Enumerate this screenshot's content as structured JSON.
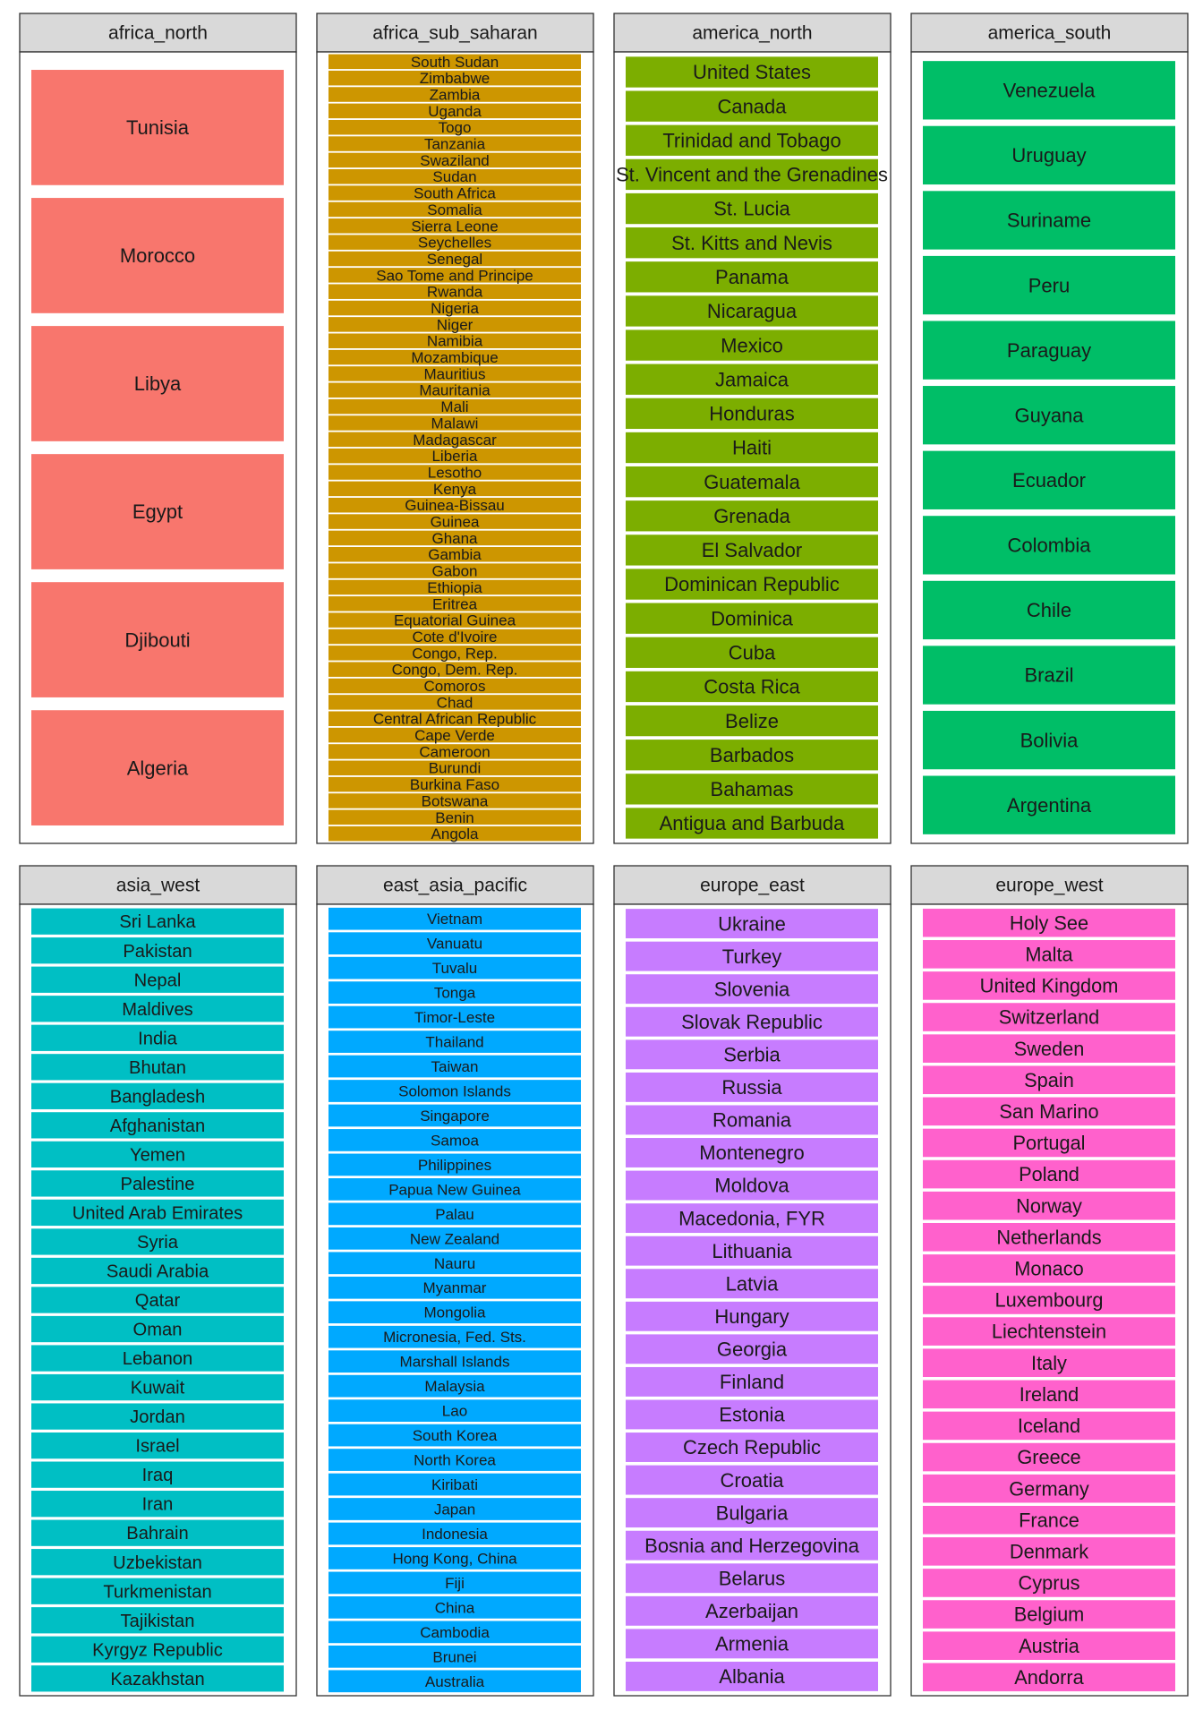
{
  "chart_data": {
    "type": "bar",
    "panels": [
      {
        "name": "africa_north",
        "color": "#F8766D",
        "categories": [
          "Tunisia",
          "Morocco",
          "Libya",
          "Egypt",
          "Djibouti",
          "Algeria"
        ]
      },
      {
        "name": "africa_sub_saharan",
        "color": "#CD9600",
        "categories": [
          "South Sudan",
          "Zimbabwe",
          "Zambia",
          "Uganda",
          "Togo",
          "Tanzania",
          "Swaziland",
          "Sudan",
          "South Africa",
          "Somalia",
          "Sierra Leone",
          "Seychelles",
          "Senegal",
          "Sao Tome and Principe",
          "Rwanda",
          "Nigeria",
          "Niger",
          "Namibia",
          "Mozambique",
          "Mauritius",
          "Mauritania",
          "Mali",
          "Malawi",
          "Madagascar",
          "Liberia",
          "Lesotho",
          "Kenya",
          "Guinea-Bissau",
          "Guinea",
          "Ghana",
          "Gambia",
          "Gabon",
          "Ethiopia",
          "Eritrea",
          "Equatorial Guinea",
          "Cote d'Ivoire",
          "Congo, Rep.",
          "Congo, Dem. Rep.",
          "Comoros",
          "Chad",
          "Central African Republic",
          "Cape Verde",
          "Cameroon",
          "Burundi",
          "Burkina Faso",
          "Botswana",
          "Benin",
          "Angola"
        ]
      },
      {
        "name": "america_north",
        "color": "#7CAE00",
        "categories": [
          "United States",
          "Canada",
          "Trinidad and Tobago",
          "St. Vincent and the Grenadines",
          "St. Lucia",
          "St. Kitts and Nevis",
          "Panama",
          "Nicaragua",
          "Mexico",
          "Jamaica",
          "Honduras",
          "Haiti",
          "Guatemala",
          "Grenada",
          "El Salvador",
          "Dominican Republic",
          "Dominica",
          "Cuba",
          "Costa Rica",
          "Belize",
          "Barbados",
          "Bahamas",
          "Antigua and Barbuda"
        ]
      },
      {
        "name": "america_south",
        "color": "#00BE67",
        "categories": [
          "Venezuela",
          "Uruguay",
          "Suriname",
          "Peru",
          "Paraguay",
          "Guyana",
          "Ecuador",
          "Colombia",
          "Chile",
          "Brazil",
          "Bolivia",
          "Argentina"
        ]
      },
      {
        "name": "asia_west",
        "color": "#00BFC4",
        "categories": [
          "Sri Lanka",
          "Pakistan",
          "Nepal",
          "Maldives",
          "India",
          "Bhutan",
          "Bangladesh",
          "Afghanistan",
          "Yemen",
          "Palestine",
          "United Arab Emirates",
          "Syria",
          "Saudi Arabia",
          "Qatar",
          "Oman",
          "Lebanon",
          "Kuwait",
          "Jordan",
          "Israel",
          "Iraq",
          "Iran",
          "Bahrain",
          "Uzbekistan",
          "Turkmenistan",
          "Tajikistan",
          "Kyrgyz Republic",
          "Kazakhstan"
        ]
      },
      {
        "name": "east_asia_pacific",
        "color": "#00A9FF",
        "categories": [
          "Vietnam",
          "Vanuatu",
          "Tuvalu",
          "Tonga",
          "Timor-Leste",
          "Thailand",
          "Taiwan",
          "Solomon Islands",
          "Singapore",
          "Samoa",
          "Philippines",
          "Papua New Guinea",
          "Palau",
          "New Zealand",
          "Nauru",
          "Myanmar",
          "Mongolia",
          "Micronesia, Fed. Sts.",
          "Marshall Islands",
          "Malaysia",
          "Lao",
          "South Korea",
          "North Korea",
          "Kiribati",
          "Japan",
          "Indonesia",
          "Hong Kong, China",
          "Fiji",
          "China",
          "Cambodia",
          "Brunei",
          "Australia"
        ]
      },
      {
        "name": "europe_east",
        "color": "#C77CFF",
        "categories": [
          "Ukraine",
          "Turkey",
          "Slovenia",
          "Slovak Republic",
          "Serbia",
          "Russia",
          "Romania",
          "Montenegro",
          "Moldova",
          "Macedonia, FYR",
          "Lithuania",
          "Latvia",
          "Hungary",
          "Georgia",
          "Finland",
          "Estonia",
          "Czech Republic",
          "Croatia",
          "Bulgaria",
          "Bosnia and Herzegovina",
          "Belarus",
          "Azerbaijan",
          "Armenia",
          "Albania"
        ]
      },
      {
        "name": "europe_west",
        "color": "#FF61CC",
        "categories": [
          "Holy See",
          "Malta",
          "United Kingdom",
          "Switzerland",
          "Sweden",
          "Spain",
          "San Marino",
          "Portugal",
          "Poland",
          "Norway",
          "Netherlands",
          "Monaco",
          "Luxembourg",
          "Liechtenstein",
          "Italy",
          "Ireland",
          "Iceland",
          "Greece",
          "Germany",
          "France",
          "Denmark",
          "Cyprus",
          "Belgium",
          "Austria",
          "Andorra"
        ]
      }
    ],
    "grid": false,
    "legend": "none"
  }
}
